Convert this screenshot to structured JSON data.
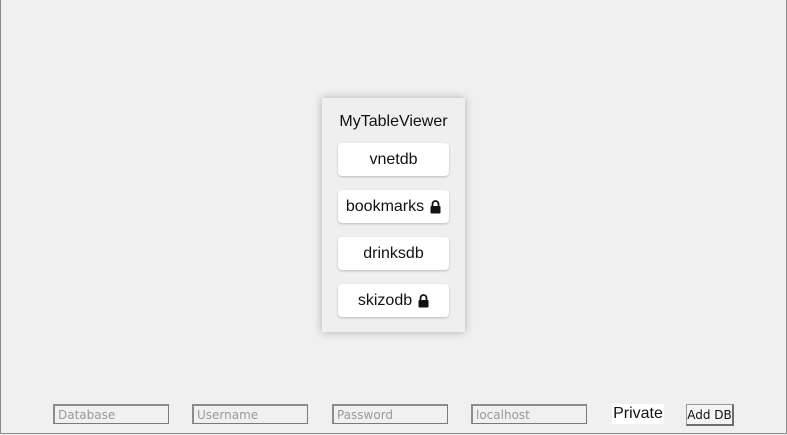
{
  "app": {
    "title": "MyTableViewer"
  },
  "databases": [
    {
      "name": "vnetdb",
      "locked": false
    },
    {
      "name": "bookmarks",
      "locked": true
    },
    {
      "name": "drinksdb",
      "locked": false
    },
    {
      "name": "skizodb",
      "locked": true
    }
  ],
  "form": {
    "database_placeholder": "Database",
    "username_placeholder": "Username",
    "password_placeholder": "Password",
    "host_placeholder": "localhost",
    "private_label": "Private",
    "add_label": "Add DB"
  },
  "icons": {
    "lock": "lock-icon"
  }
}
